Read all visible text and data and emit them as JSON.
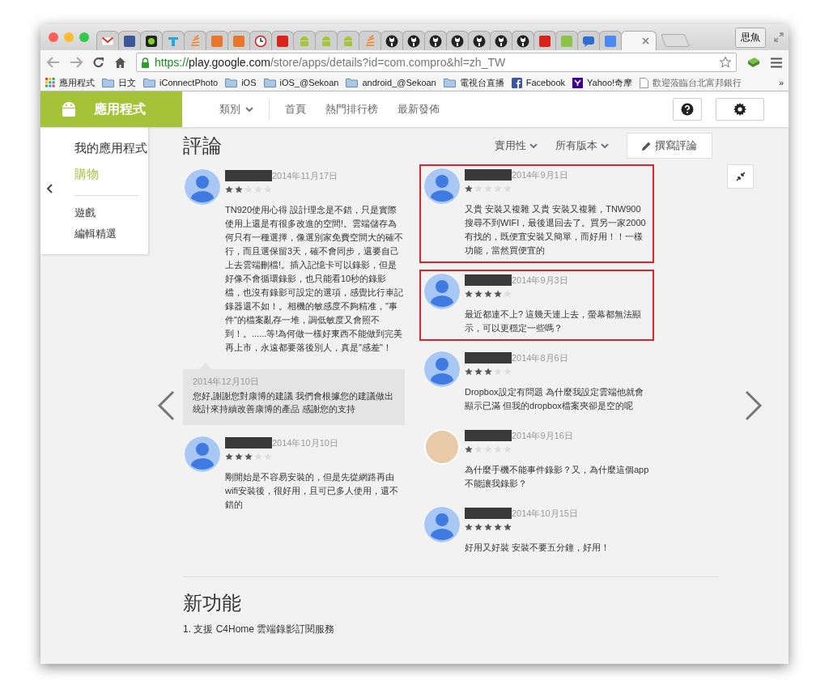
{
  "browser": {
    "tabs": [
      {
        "kind": "gmail",
        "selected": false
      },
      {
        "kind": "facebook",
        "selected": false
      },
      {
        "kind": "green-dot",
        "selected": false
      },
      {
        "kind": "tool",
        "selected": false
      },
      {
        "kind": "stack",
        "selected": false
      },
      {
        "kind": "orange-block",
        "selected": false
      },
      {
        "kind": "orange-block",
        "selected": false
      },
      {
        "kind": "timer",
        "selected": false
      },
      {
        "kind": "red-block",
        "selected": false
      },
      {
        "kind": "android",
        "selected": false
      },
      {
        "kind": "android",
        "selected": false
      },
      {
        "kind": "android",
        "selected": false
      },
      {
        "kind": "stack",
        "selected": false
      },
      {
        "kind": "github",
        "selected": false
      },
      {
        "kind": "github",
        "selected": false
      },
      {
        "kind": "github",
        "selected": false
      },
      {
        "kind": "github",
        "selected": false
      },
      {
        "kind": "github",
        "selected": false
      },
      {
        "kind": "github",
        "selected": false
      },
      {
        "kind": "github",
        "selected": false
      },
      {
        "kind": "red-block",
        "selected": false
      },
      {
        "kind": "puzzle",
        "selected": false
      },
      {
        "kind": "chat",
        "selected": false
      },
      {
        "kind": "blue-block",
        "selected": false
      },
      {
        "kind": "blank",
        "selected": true
      }
    ],
    "profile": "思魚",
    "url": {
      "scheme": "https://",
      "host": "play.google.com",
      "path": "/store/apps/details?id=com.compro&hl=zh_TW"
    },
    "bookmarks": [
      {
        "kind": "apps",
        "label": "應用程式"
      },
      {
        "kind": "folder",
        "label": "日文"
      },
      {
        "kind": "folder",
        "label": "iConnectPhoto"
      },
      {
        "kind": "folder",
        "label": "iOS"
      },
      {
        "kind": "folder",
        "label": "iOS_@Sekoan"
      },
      {
        "kind": "folder",
        "label": "android_@Sekoan"
      },
      {
        "kind": "folder",
        "label": "電視台直播"
      },
      {
        "kind": "facebook",
        "label": "Facebook"
      },
      {
        "kind": "yahoo",
        "label": "Yahoo!奇摩"
      },
      {
        "kind": "page",
        "label": "歡迎蒞臨台北富邦銀行"
      }
    ],
    "more": "»"
  },
  "store": {
    "section": "應用程式",
    "nav": [
      {
        "label": "類別",
        "dropdown": true
      },
      {
        "label": "首頁",
        "dropdown": false
      },
      {
        "label": "熱門排行榜",
        "dropdown": false
      },
      {
        "label": "最新發佈",
        "dropdown": false
      }
    ],
    "sidebar": [
      {
        "label": "我的應用程式",
        "selected": false,
        "kind": "main"
      },
      {
        "label": "購物",
        "selected": true,
        "kind": "main"
      },
      {
        "label": "遊戲",
        "selected": false,
        "kind": "sub"
      },
      {
        "label": "編輯精選",
        "selected": false,
        "kind": "sub"
      }
    ]
  },
  "reviews": {
    "title": "評論",
    "filters": [
      "實用性",
      "所有版本"
    ],
    "write_button": "撰寫評論",
    "columns": [
      [
        {
          "kind": "default-avatar",
          "date": "2014年11月17日",
          "stars": 2,
          "highlighted": false,
          "text": "TN920使用心得 設計理念是不錯，只是實際使用上還是有很多改進的空間!。雲端儲存為何只有一種選擇，像選別家免費空間大的確不行，而且選保留3天，確不會同步，還要自己上去雲端刪檔!。插入記憶卡可以錄影，但是好像不會循環錄影，也只能看10秒的錄影檔，也沒有錄影可設定的選項，感覺比行車記錄器還不如！。相機的敏感度不夠精准，\"事件\"的檔案亂存一堆，調低敏度又會照不到！。......等!為何做一樣好東西不能做到完美再上市，永遠都要落後別人，真是\"感差\"！",
          "reply": {
            "date": "2014年12月10日",
            "text": "您好,謝謝您對康博的建議 我們會根據您的建議做出統計來持續改善康博的產品 感謝您的支持"
          }
        },
        {
          "kind": "default-avatar",
          "date": "2014年10月10日",
          "stars": 3,
          "highlighted": false,
          "text": "剛開始是不容易安裝的，但是先從網路再由wifi安裝後，很好用，且可已多人使用，還不錯的"
        }
      ],
      [
        {
          "kind": "default-avatar",
          "date": "2014年9月1日",
          "stars": 1,
          "highlighted": true,
          "text": "又貴 安裝又複雜 又貴 安裝又複雜，TNW900搜尋不到WIFI，最後退回去了。買另一家2000有找的，既便宜安裝又簡單，而好用！！一樣功能，當然買便宜的"
        },
        {
          "kind": "default-avatar",
          "date": "2014年9月3日",
          "stars": 4,
          "highlighted": true,
          "text": "最近都連不上? 這幾天連上去，螢幕都無法顯示，可以更穩定一些嗎？"
        },
        {
          "kind": "default-avatar",
          "date": "2014年8月6日",
          "stars": 3,
          "highlighted": false,
          "text": "Dropbox設定有問題 為什麼我設定雲端他就會顯示已滿 但我的dropbox檔案夾卻是空的呢"
        },
        {
          "kind": "photo-avatar",
          "date": "2014年9月16日",
          "stars": 1,
          "highlighted": false,
          "text": "為什麼手機不能事件錄影？又，為什麼這個app不能讓我錄影？"
        },
        {
          "kind": "default-avatar",
          "date": "2014年10月15日",
          "stars": 5,
          "highlighted": false,
          "text": "好用又好裝 安裝不要五分鐘，好用！"
        }
      ]
    ]
  },
  "whats_new": {
    "title": "新功能",
    "items": [
      "1. 支援 C4Home 雲端錄影訂閱服務"
    ]
  }
}
